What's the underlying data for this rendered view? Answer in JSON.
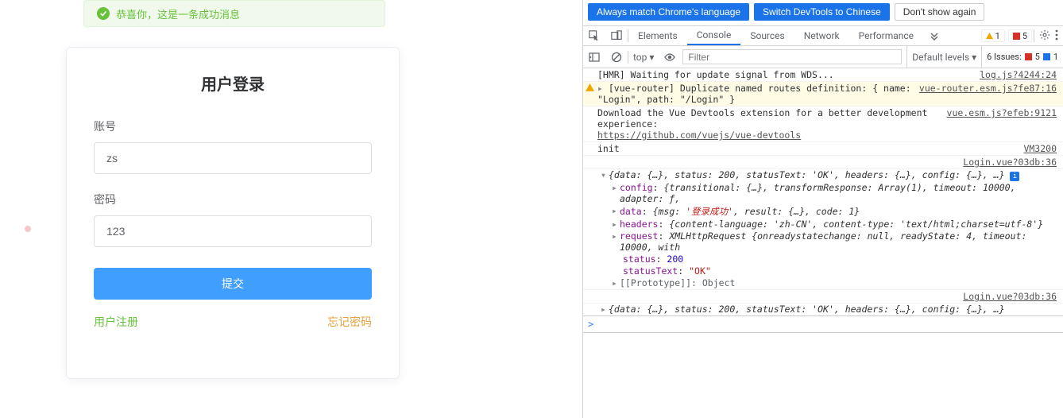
{
  "alert": {
    "text": "恭喜你，这是一条成功消息"
  },
  "login": {
    "title": "用户登录",
    "account_label": "账号",
    "account_value": "zs",
    "password_label": "密码",
    "password_value": "123",
    "submit": "提交",
    "register": "用户注册",
    "forgot": "忘记密码"
  },
  "dev": {
    "btn1": "Always match Chrome's language",
    "btn2": "Switch DevTools to Chinese",
    "btn3": "Don't show again",
    "tabs": {
      "elements": "Elements",
      "console": "Console",
      "sources": "Sources",
      "network": "Network",
      "performance": "Performance"
    },
    "warn_count": "1",
    "err_count": "5",
    "top": "top",
    "filter_ph": "Filter",
    "levels": "Default levels",
    "issues_label": "6 Issues:",
    "issues_err": "5",
    "issues_info": "1",
    "logs": {
      "hmr": "[HMR] Waiting for update signal from WDS...",
      "hmr_src": "log.js?4244:24",
      "router_a": "[vue-router] Duplicate named routes definition: { name: \"Login\", path: \"/Login\" }",
      "router_src": "vue-router.esm.js?fe87:16",
      "vdev1": "Download the Vue Devtools extension for a better development experience:",
      "vdev_link": "https://github.com/vuejs/vue-devtools",
      "vdev_src": "vue.esm.js?efeb:9121",
      "init": "init",
      "init_src": "VM3200",
      "login_src": "Login.vue?03db:36",
      "obj_open": "{data: {…}, status: 200, statusText: 'OK', headers: {…}, config: {…}, …}",
      "config": "{transitional: {…}, transformResponse: Array(1), timeout: 10000, adapter: ƒ,",
      "data_line_pre": "{msg:",
      "data_msg": "'登录成功'",
      "data_line_post": ", result: {…}, code: 1}",
      "headers": "{content-language: 'zh-CN', content-type: 'text/html;charset=utf-8'}",
      "request": "XMLHttpRequest {onreadystatechange: null, readyState: 4, timeout: 10000, with",
      "status": "200",
      "statusText": "\"OK\"",
      "proto": "[[Prototype]]: Object",
      "obj2": "{data: {…}, status: 200, statusText: 'OK', headers: {…}, config: {…}, …}",
      "prompt": ">"
    }
  }
}
